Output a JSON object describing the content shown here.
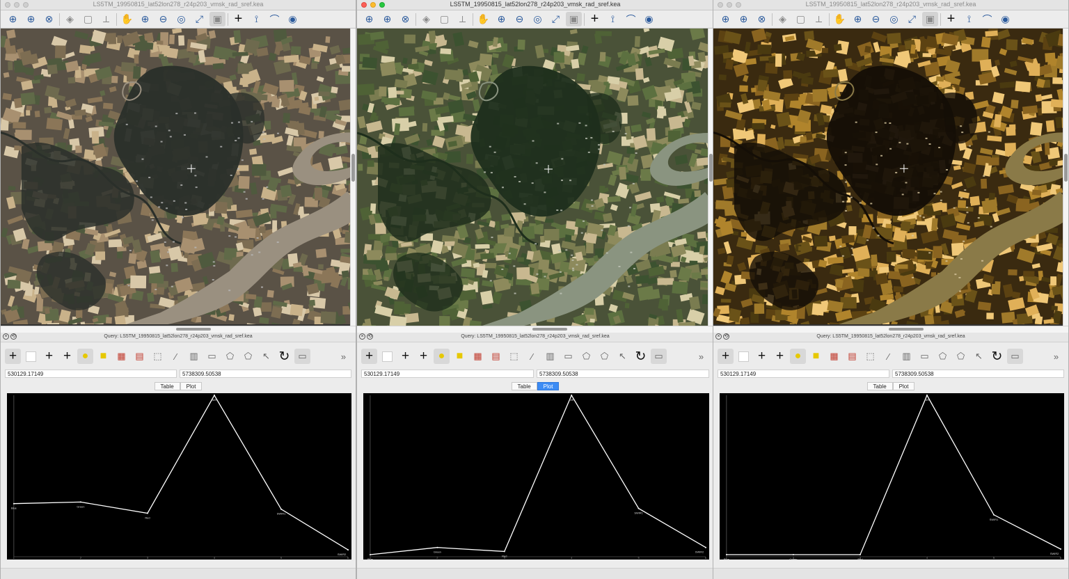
{
  "windows": [
    {
      "title": "LS5TM_19950815_lat52lon278_r24p203_vmsk_rad_sref.kea",
      "active": false,
      "image_tint": "natural",
      "query": {
        "title": "Query: LS5TM_19950815_lat52lon278_r24p203_vmsk_rad_sref.kea",
        "easting": "530129.17149",
        "northing": "5738309.50538",
        "tabs": [
          "Table",
          "Plot"
        ],
        "selected_tab": "",
        "chart_data": {
          "type": "line",
          "x": [
            1,
            2,
            3,
            4,
            5,
            6
          ],
          "point_labels": [
            "Blue",
            "Green",
            "Red",
            "NIR",
            "SWIR1",
            "SWIR2"
          ],
          "values": [
            640,
            660,
            520,
            2000,
            570,
            60
          ],
          "ylim": [
            0,
            2000
          ],
          "grid": false
        }
      }
    },
    {
      "title": "LS5TM_19950815_lat52lon278_r24p203_vmsk_rad_sref.kea",
      "active": true,
      "image_tint": "green",
      "query": {
        "title": "Query: LS5TM_19950815_lat52lon278_r24p203_vmsk_rad_sref.kea",
        "easting": "530129.17149",
        "northing": "5738309.50538",
        "tabs": [
          "Table",
          "Plot"
        ],
        "selected_tab": "Plot",
        "chart_data": {
          "type": "line",
          "x": [
            1,
            2,
            3,
            4,
            5,
            6
          ],
          "point_labels": [
            "Blue",
            "Green",
            "Red",
            "NIR",
            "SWIR1",
            "SWIR2"
          ],
          "values": [
            0,
            90,
            40,
            2000,
            580,
            90
          ],
          "ylim": [
            0,
            2000
          ],
          "grid": false
        }
      }
    },
    {
      "title": "LS5TM_19950815_lat52lon278_r24p203_vmsk_rad_sref.kea",
      "active": false,
      "image_tint": "amber",
      "query": {
        "title": "Query: LS5TM_19950815_lat52lon278_r24p203_vmsk_rad_sref.kea",
        "easting": "530129.17149",
        "northing": "5738309.50538",
        "tabs": [
          "Table",
          "Plot"
        ],
        "selected_tab": "",
        "chart_data": {
          "type": "line",
          "x": [
            1,
            2,
            3,
            4,
            5,
            6
          ],
          "point_labels": [
            "Blue",
            "Green",
            "Red",
            "NIR",
            "SWIR1",
            "SWIR2"
          ],
          "values": [
            0,
            0,
            0,
            2000,
            500,
            70
          ],
          "ylim": [
            0,
            2000
          ],
          "grid": false
        }
      }
    }
  ],
  "toolbar_icons": [
    "add-layer-icon",
    "add-vector-icon",
    "remove-layer-icon",
    "layers-icon",
    "new-window-icon",
    "arrange-icon",
    "pan-icon",
    "zoom-in-icon",
    "zoom-out-icon",
    "zoom-native-icon",
    "zoom-fit-icon",
    "follow-extent-icon",
    "query-cursor-icon",
    "profile-icon",
    "stretch-icon",
    "viewer-eye-icon"
  ],
  "query_icons": [
    "crosshair-icon",
    "color-swatch-icon",
    "add-field-icon",
    "add-column-icon",
    "highlight-icon",
    "select-icon",
    "clear-selection-icon",
    "table-icon",
    "polygon-select-icon",
    "edit-icon",
    "save-icon",
    "calc-icon",
    "geom-select-icon",
    "line-select-icon",
    "cursor-select-icon",
    "refresh-icon",
    "label-icon",
    "more-icon"
  ],
  "colors": {
    "plot_bg": "#000000",
    "plot_line": "#ffffff",
    "tab_selected": "#3d8cf4"
  }
}
